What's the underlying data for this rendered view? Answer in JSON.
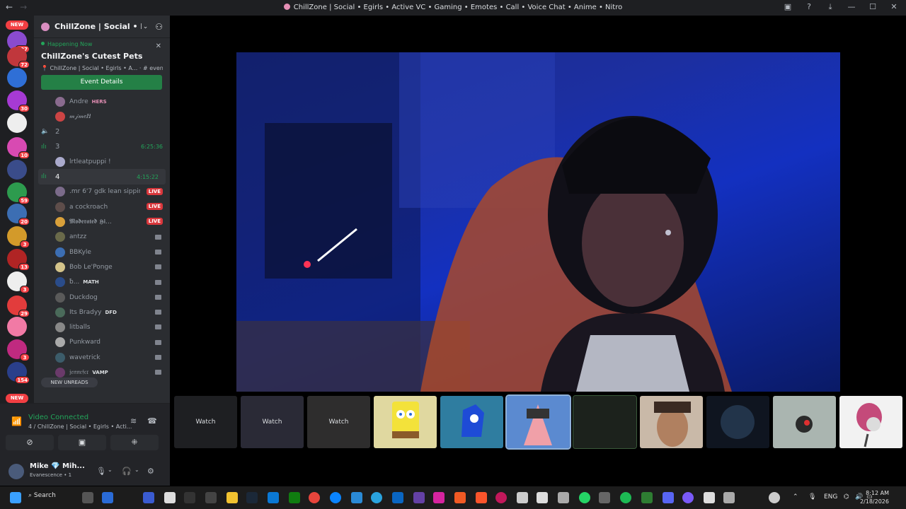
{
  "window": {
    "title": "ChillZone | Social • Egirls • Active VC • Gaming • Emotes • Call • Voice Chat • Anime • Nitro",
    "back_icon": "←",
    "forward_icon": "→"
  },
  "guilds": {
    "top_pill": "NEW",
    "bottom_pill": "NEW",
    "badges": [
      "237",
      "72",
      "",
      "30",
      "",
      "10",
      "",
      "59",
      "20",
      "3",
      "13",
      "3",
      "29",
      "",
      "3",
      "154"
    ]
  },
  "server": {
    "name": "ChillZone | Social • Egir..."
  },
  "event": {
    "status": "Happening Now",
    "name": "ChillZone's Cutest Pets",
    "location": "ChillZone | Social • Egirls • A...",
    "channel": "# events",
    "button": "Event Details"
  },
  "channel_list": {
    "users_top": [
      {
        "name": "Andre",
        "tag": "HERS"
      },
      {
        "name": "𝓂𝒿𝓂𝑒𝐻",
        "tag": ""
      }
    ],
    "vc2": {
      "name": "2"
    },
    "vc3": {
      "name": "3",
      "timer": "6:25:36"
    },
    "vc3_user": {
      "name": "lrtleatpuppi !"
    },
    "vc4": {
      "name": "4",
      "timer": "4:15:22"
    },
    "vc4_users": [
      {
        "name": ".mr 6'7 gdk lean sippin ...",
        "tag": "",
        "live": "LIVE"
      },
      {
        "name": "a cockroach",
        "tag": "",
        "live": "LIVE"
      },
      {
        "name": "𝕸𝖔𝖉𝖊𝖗𝖆𝖙𝖊𝖉 𝕳𝖎...",
        "tag": "",
        "live": "LIVE"
      },
      {
        "name": "antzz",
        "tag": "",
        "live": ""
      },
      {
        "name": "BBKyle",
        "tag": "",
        "live": ""
      },
      {
        "name": "Bob Le'Ponge",
        "tag": "",
        "live": ""
      },
      {
        "name": "ƀ...",
        "tag": "MATH",
        "live": ""
      },
      {
        "name": "Duckdog",
        "tag": "",
        "live": ""
      },
      {
        "name": "Its Bradyy",
        "tag": "DFD",
        "live": ""
      },
      {
        "name": "litballs",
        "tag": "",
        "live": ""
      },
      {
        "name": "Punkward",
        "tag": "",
        "live": ""
      },
      {
        "name": "wavetrick",
        "tag": "",
        "live": ""
      },
      {
        "name": "𝔧𝔢𝔫𝔫𝔢𝔣𝔢𝔯",
        "tag": "VAMP",
        "live": ""
      }
    ],
    "new_unreads": "NEW UNREADS"
  },
  "voice_panel": {
    "status": "Video Connected",
    "location": "4 / ChillZone | Social • Egirls • Acti...",
    "user_name": "Mike 💎 Mih...",
    "user_status": "Evanescence • 1"
  },
  "tiles": {
    "watch_label": "Watch"
  },
  "taskbar": {
    "search": "Search",
    "lang": "ENG",
    "time": "8:12 AM",
    "date": "2/18/2026"
  }
}
